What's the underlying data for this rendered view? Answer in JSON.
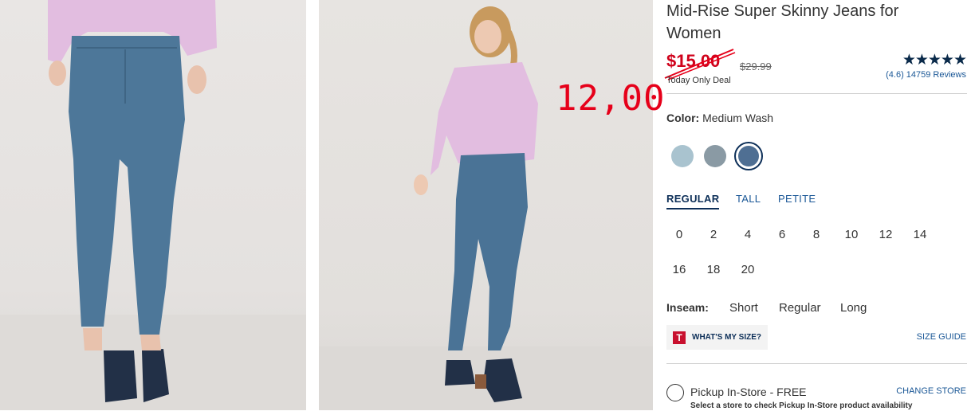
{
  "product": {
    "title": "Mid-Rise Super Skinny Jeans for Women",
    "sale_price": "$15.00",
    "original_price": "$29.99",
    "deal_label": "Today Only Deal",
    "stars": "★★★★★",
    "rating_text": "(4.6) 14759 Reviews"
  },
  "annotation": {
    "handwritten_price": "12,00",
    "color": "#e6001a"
  },
  "color": {
    "label": "Color:",
    "value": "Medium Wash",
    "swatches": [
      {
        "name": "light-wash",
        "hex": "#a9c3cf"
      },
      {
        "name": "gray-wash",
        "hex": "#8a9aa4"
      },
      {
        "name": "medium-wash",
        "hex": "#4f6f93",
        "selected": true
      }
    ]
  },
  "fit_tabs": [
    "REGULAR",
    "TALL",
    "PETITE"
  ],
  "sizes_row1": [
    "0",
    "2",
    "4",
    "6",
    "8",
    "10",
    "12",
    "14"
  ],
  "sizes_row2": [
    "16",
    "18",
    "20"
  ],
  "inseam": {
    "label": "Inseam:",
    "options": [
      "Short",
      "Regular",
      "Long"
    ]
  },
  "size_help": {
    "logo": "T",
    "whats_my_size": "WHAT'S MY SIZE?",
    "size_guide": "SIZE GUIDE"
  },
  "pickup": {
    "label": "Pickup In-Store - FREE",
    "change_store": "CHANGE STORE",
    "note": "Select a store to check Pickup In-Store product availability"
  },
  "colors": {
    "accent": "#0d2f58",
    "link": "#1a5796",
    "sale": "#d0021b"
  }
}
